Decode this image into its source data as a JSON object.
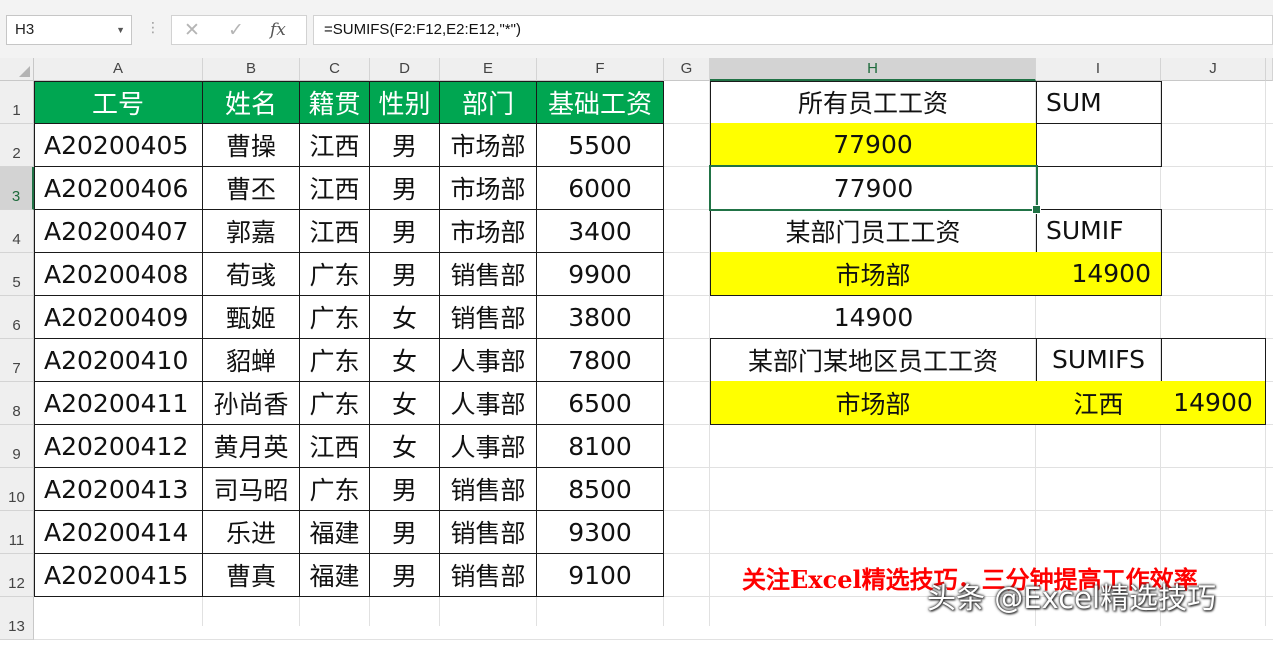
{
  "formula_bar": {
    "name_box": "H3",
    "formula": "=SUMIFS(F2:F12,E2:E12,\"*\")",
    "cancel_icon": "✕",
    "enter_icon": "✓",
    "fx_label": "fx",
    "separator": "⋮"
  },
  "sheet": {
    "selected_cell": "H3",
    "columns": [
      "A",
      "B",
      "C",
      "D",
      "E",
      "F",
      "G",
      "H",
      "I",
      "J"
    ],
    "rows": [
      "1",
      "2",
      "3",
      "4",
      "5",
      "6",
      "7",
      "8",
      "9",
      "10",
      "11",
      "12",
      "13"
    ]
  },
  "table": {
    "headers": [
      "工号",
      "姓名",
      "籍贯",
      "性别",
      "部门",
      "基础工资"
    ],
    "rows": [
      [
        "A20200405",
        "曹操",
        "江西",
        "男",
        "市场部",
        "5500"
      ],
      [
        "A20200406",
        "曹丕",
        "江西",
        "男",
        "市场部",
        "6000"
      ],
      [
        "A20200407",
        "郭嘉",
        "江西",
        "男",
        "市场部",
        "3400"
      ],
      [
        "A20200408",
        "荀彧",
        "广东",
        "男",
        "销售部",
        "9900"
      ],
      [
        "A20200409",
        "甄姬",
        "广东",
        "女",
        "销售部",
        "3800"
      ],
      [
        "A20200410",
        "貂蝉",
        "广东",
        "女",
        "人事部",
        "7800"
      ],
      [
        "A20200411",
        "孙尚香",
        "广东",
        "女",
        "人事部",
        "6500"
      ],
      [
        "A20200412",
        "黄月英",
        "江西",
        "女",
        "人事部",
        "8100"
      ],
      [
        "A20200413",
        "司马昭",
        "广东",
        "男",
        "销售部",
        "8500"
      ],
      [
        "A20200414",
        "乐进",
        "福建",
        "男",
        "销售部",
        "9300"
      ],
      [
        "A20200415",
        "曹真",
        "福建",
        "男",
        "销售部",
        "9100"
      ]
    ]
  },
  "summary": {
    "all_label": "所有员工工资",
    "sum_label": "SUM",
    "all_total": "77900",
    "all_total_sumifs": "77900",
    "dept_label": "某部门员工工资",
    "sumif_label": "SUMIF",
    "dept_value": "市场部",
    "dept_total": "14900",
    "dept_total_plain": "14900",
    "dept_region_label": "某部门某地区员工工资",
    "sumifs_label": "SUMIFS",
    "dept2_value": "市场部",
    "region_value": "江西",
    "dept_region_total": "14900"
  },
  "promo_text": "关注Excel精选技巧，三分钟提高工作效率",
  "watermark": "头条 @Excel精选技巧",
  "colors": {
    "header_green": "#00a651",
    "highlight_yellow": "#ffff00",
    "promo_red": "#ff0000",
    "excel_green": "#217346"
  }
}
